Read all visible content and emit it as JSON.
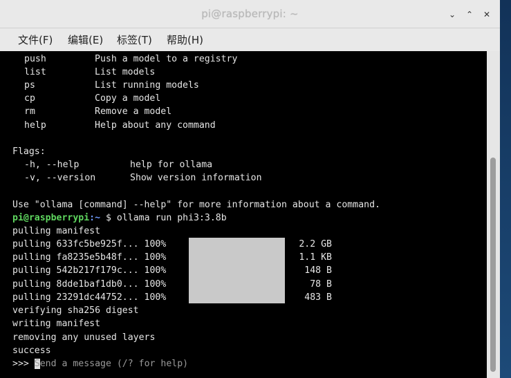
{
  "window": {
    "title_user": "pi@raspberrypi:",
    "title_path": " ~",
    "buttons": {
      "minimize": "⌄",
      "maximize": "⌃",
      "close": "✕"
    }
  },
  "menubar": {
    "items": [
      "文件(F)",
      "编辑(E)",
      "标签(T)",
      "帮助(H)"
    ]
  },
  "terminal": {
    "commands": [
      {
        "name": "push",
        "desc": "Push a model to a registry"
      },
      {
        "name": "list",
        "desc": "List models"
      },
      {
        "name": "ps",
        "desc": "List running models"
      },
      {
        "name": "cp",
        "desc": "Copy a model"
      },
      {
        "name": "rm",
        "desc": "Remove a model"
      },
      {
        "name": "help",
        "desc": "Help about any command"
      }
    ],
    "flags_header": "Flags:",
    "flags": [
      {
        "name": "-h, --help",
        "desc": "help for ollama"
      },
      {
        "name": "-v, --version",
        "desc": "Show version information"
      }
    ],
    "usage": "Use \"ollama [command] --help\" for more information about a command.",
    "prompt_user": "pi@raspberrypi",
    "prompt_path": ":~",
    "prompt_symbol": " $ ",
    "command": "ollama run phi3:3.8b",
    "pulling_manifest": "pulling manifest",
    "pulls": [
      {
        "label": "pulling 633fc5be925f... 100%",
        "size": "2.2 GB",
        "progress": 1.0
      },
      {
        "label": "pulling fa8235e5b48f... 100%",
        "size": "1.1 KB",
        "progress": 1.0
      },
      {
        "label": "pulling 542b217f179c... 100%",
        "size": "148 B",
        "progress": 1.0
      },
      {
        "label": "pulling 8dde1baf1db0... 100%",
        "size": "78 B",
        "progress": 1.0
      },
      {
        "label": "pulling 23291dc44752... 100%",
        "size": "483 B",
        "progress": 1.0
      }
    ],
    "verifying": "verifying sha256 digest",
    "writing": "writing manifest",
    "removing": "removing any unused layers",
    "success": "success",
    "chat_prompt": ">>> ",
    "chat_cursor_char": "S",
    "chat_placeholder": "end a message (/? for help)"
  },
  "colors": {
    "terminal_bg": "#000000",
    "terminal_fg": "#e6e6e6",
    "prompt_user": "#5fd75f",
    "prompt_path": "#6f9bff",
    "progress_fill": "#c9c9c9"
  }
}
